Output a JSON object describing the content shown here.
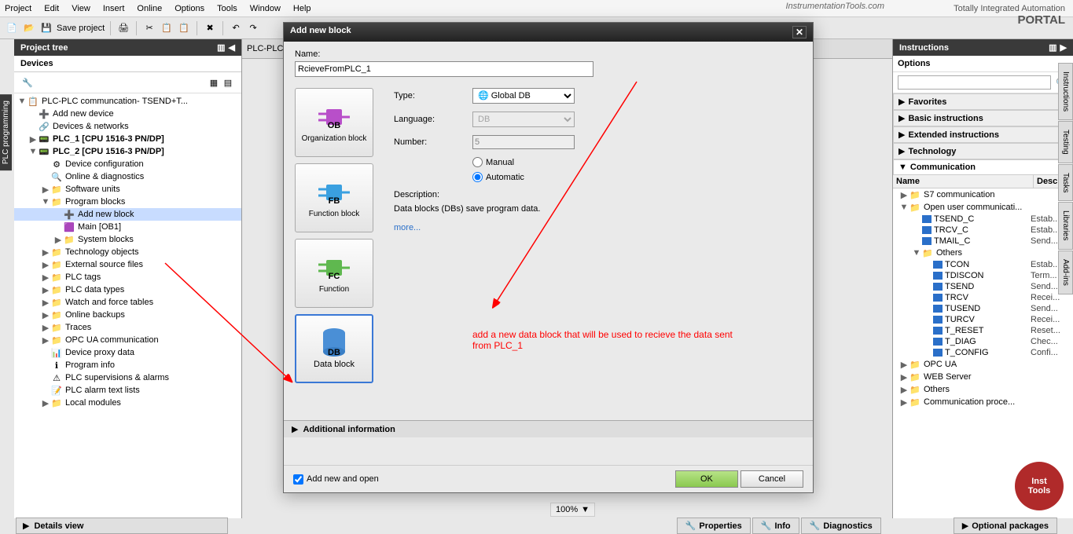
{
  "menubar": [
    "Project",
    "Edit",
    "View",
    "Insert",
    "Online",
    "Options",
    "Tools",
    "Window",
    "Help"
  ],
  "branding": "InstrumentationTools.com",
  "portal": {
    "line1": "Totally Integrated Automation",
    "line2": "PORTAL"
  },
  "toolbar": {
    "save": "Save project"
  },
  "left": {
    "title": "Project tree",
    "devices": "Devices",
    "sidetab": "PLC programming"
  },
  "tree": {
    "root": "PLC-PLC communcation- TSEND+T...",
    "items": [
      {
        "pad": 18,
        "ico": "➕",
        "lbl": "Add new device"
      },
      {
        "pad": 18,
        "ico": "🔗",
        "lbl": "Devices & networks"
      },
      {
        "pad": 18,
        "exp": "▶",
        "ico": "📟",
        "lbl": "PLC_1 [CPU 1516-3 PN/DP]",
        "b": true
      },
      {
        "pad": 18,
        "exp": "▼",
        "ico": "📟",
        "lbl": "PLC_2 [CPU 1516-3 PN/DP]",
        "b": true
      },
      {
        "pad": 34,
        "ico": "⚙",
        "lbl": "Device configuration"
      },
      {
        "pad": 34,
        "ico": "🔍",
        "lbl": "Online & diagnostics"
      },
      {
        "pad": 34,
        "exp": "▶",
        "ico": "📁",
        "lbl": "Software units"
      },
      {
        "pad": 34,
        "exp": "▼",
        "ico": "📁",
        "lbl": "Program blocks"
      },
      {
        "pad": 50,
        "ico": "➕",
        "lbl": "Add new block",
        "sel": true
      },
      {
        "pad": 50,
        "ico": "🟪",
        "lbl": "Main [OB1]"
      },
      {
        "pad": 50,
        "exp": "▶",
        "ico": "📁",
        "lbl": "System blocks"
      },
      {
        "pad": 34,
        "exp": "▶",
        "ico": "📁",
        "lbl": "Technology objects"
      },
      {
        "pad": 34,
        "exp": "▶",
        "ico": "📁",
        "lbl": "External source files"
      },
      {
        "pad": 34,
        "exp": "▶",
        "ico": "📁",
        "lbl": "PLC tags"
      },
      {
        "pad": 34,
        "exp": "▶",
        "ico": "📁",
        "lbl": "PLC data types"
      },
      {
        "pad": 34,
        "exp": "▶",
        "ico": "📁",
        "lbl": "Watch and force tables"
      },
      {
        "pad": 34,
        "exp": "▶",
        "ico": "📁",
        "lbl": "Online backups"
      },
      {
        "pad": 34,
        "exp": "▶",
        "ico": "📁",
        "lbl": "Traces"
      },
      {
        "pad": 34,
        "exp": "▶",
        "ico": "📁",
        "lbl": "OPC UA communication"
      },
      {
        "pad": 34,
        "ico": "📊",
        "lbl": "Device proxy data"
      },
      {
        "pad": 34,
        "ico": "ℹ",
        "lbl": "Program info"
      },
      {
        "pad": 34,
        "ico": "⚠",
        "lbl": "PLC supervisions & alarms"
      },
      {
        "pad": 34,
        "ico": "📝",
        "lbl": "PLC alarm text lists"
      },
      {
        "pad": 34,
        "exp": "▶",
        "ico": "📁",
        "lbl": "Local modules"
      }
    ]
  },
  "details": "Details view",
  "dialog": {
    "title": "Add new block",
    "nameLabel": "Name:",
    "nameValue": "RcieveFromPLC_1",
    "blocks": [
      {
        "lbl": "Organization block",
        "tag": "OB",
        "color": "#b84fc9"
      },
      {
        "lbl": "Function block",
        "tag": "FB",
        "color": "#3aa0e0"
      },
      {
        "lbl": "Function",
        "tag": "FC",
        "color": "#5fb84f"
      },
      {
        "lbl": "Data block",
        "tag": "DB",
        "color": "#2a6fc9",
        "sel": true
      }
    ],
    "typeLabel": "Type:",
    "typeValue": "Global DB",
    "langLabel": "Language:",
    "langValue": "DB",
    "numLabel": "Number:",
    "numValue": "5",
    "manual": "Manual",
    "auto": "Automatic",
    "descLabel": "Description:",
    "descText": "Data blocks (DBs) save program data.",
    "more": "more...",
    "addInfo": "Additional information",
    "addOpen": "Add new and open",
    "ok": "OK",
    "cancel": "Cancel"
  },
  "annotation": "add a new data block that will be used to recieve the data sent from PLC_1",
  "right": {
    "title": "Instructions",
    "options": "Options",
    "accs": [
      "Favorites",
      "Basic instructions",
      "Extended instructions",
      "Technology",
      "Communication"
    ],
    "hdr": {
      "name": "Name",
      "desc": "Desc..."
    },
    "items": [
      {
        "pad": 4,
        "exp": "▶",
        "ico": "📁",
        "lbl": "S7 communication",
        "d": ""
      },
      {
        "pad": 4,
        "exp": "▼",
        "ico": "📁",
        "lbl": "Open user communicati...",
        "d": ""
      },
      {
        "pad": 30,
        "blk": true,
        "lbl": "TSEND_C",
        "d": "Estab..."
      },
      {
        "pad": 30,
        "blk": true,
        "lbl": "TRCV_C",
        "d": "Estab..."
      },
      {
        "pad": 30,
        "blk": true,
        "lbl": "TMAIL_C",
        "d": "Send..."
      },
      {
        "pad": 20,
        "exp": "▼",
        "ico": "📁",
        "lbl": "Others",
        "d": ""
      },
      {
        "pad": 44,
        "blk": true,
        "lbl": "TCON",
        "d": "Estab..."
      },
      {
        "pad": 44,
        "blk": true,
        "lbl": "TDISCON",
        "d": "Term..."
      },
      {
        "pad": 44,
        "blk": true,
        "lbl": "TSEND",
        "d": "Send..."
      },
      {
        "pad": 44,
        "blk": true,
        "lbl": "TRCV",
        "d": "Recei..."
      },
      {
        "pad": 44,
        "blk": true,
        "lbl": "TUSEND",
        "d": "Send..."
      },
      {
        "pad": 44,
        "blk": true,
        "lbl": "TURCV",
        "d": "Recei..."
      },
      {
        "pad": 44,
        "blk": true,
        "lbl": "T_RESET",
        "d": "Reset..."
      },
      {
        "pad": 44,
        "blk": true,
        "lbl": "T_DIAG",
        "d": "Chec..."
      },
      {
        "pad": 44,
        "blk": true,
        "lbl": "T_CONFIG",
        "d": "Confi..."
      },
      {
        "pad": 4,
        "exp": "▶",
        "ico": "📁",
        "lbl": "OPC UA",
        "d": ""
      },
      {
        "pad": 4,
        "exp": "▶",
        "ico": "📁",
        "lbl": "WEB Server",
        "d": ""
      },
      {
        "pad": 4,
        "exp": "▶",
        "ico": "📁",
        "lbl": "Others",
        "d": ""
      },
      {
        "pad": 4,
        "exp": "▶",
        "ico": "📁",
        "lbl": "Communication proce...",
        "d": ""
      }
    ],
    "optpkg": "Optional packages",
    "tabs": [
      "Instructions",
      "Testing",
      "Tasks",
      "Libraries",
      "Add-ins"
    ]
  },
  "bottomTabs": [
    "Properties",
    "Info",
    "Diagnostics"
  ],
  "zoom": "100%",
  "badge": {
    "l1": "Inst",
    "l2": "Tools"
  }
}
